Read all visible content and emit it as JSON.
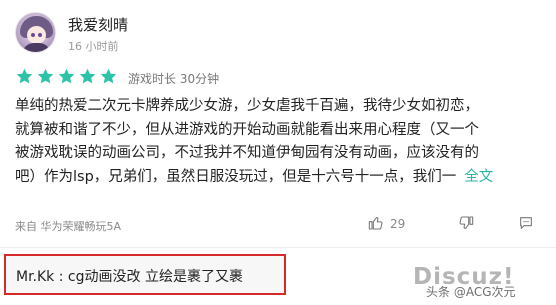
{
  "user": {
    "name": "我爱刻晴",
    "time": "16 小时前"
  },
  "rating": {
    "stars": 5,
    "max": 5,
    "playtime_label": "游戏时长 30分钟",
    "star_color": "#2cc3a8"
  },
  "review": {
    "lines": [
      "单纯的热爱二次元卡牌养成少女游，少女虐我千百遍，我待少女如初恋，",
      "就算被和谐了不少，但从进游戏的开始动画就能看出来用心程度（又一个",
      "被游戏耽误的动画公司，不过我并不知道伊甸园有没有动画，应该没有的",
      "吧）作为lsp，兄弟们，虽然日服没玩过，但是十六号十一点，我们一"
    ],
    "expand_label": "全文"
  },
  "footer": {
    "device": "来自 华为荣耀畅玩5A",
    "likes": "29",
    "icons": [
      "thumbs-up-icon",
      "thumbs-down-icon",
      "comment-icon"
    ]
  },
  "reply": {
    "text": "Mr.Kk : cg动画没改 立绘是裹了又裹"
  },
  "watermark": {
    "logo": "Discuz!",
    "caption": "头条 @ACG次元"
  }
}
